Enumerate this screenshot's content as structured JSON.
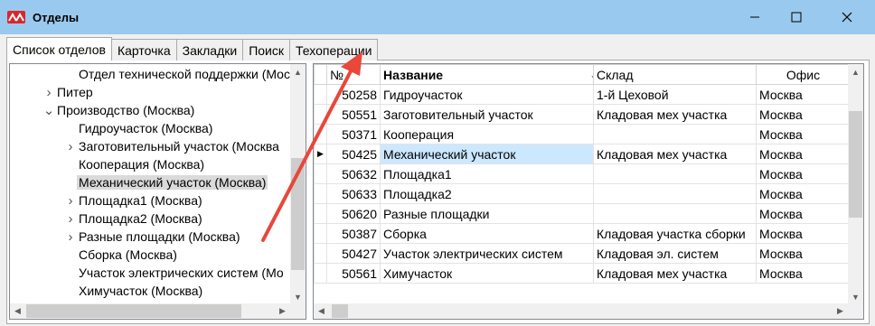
{
  "window": {
    "title": "Отделы"
  },
  "tabs": [
    {
      "label": "Список отделов",
      "active": true
    },
    {
      "label": "Карточка",
      "active": false
    },
    {
      "label": "Закладки",
      "active": false
    },
    {
      "label": "Поиск",
      "active": false
    },
    {
      "label": "Техоперации",
      "active": false
    }
  ],
  "tree": {
    "items": [
      {
        "label": "Отдел технической поддержки (Москва",
        "level": 1,
        "expander": "none",
        "selected": false
      },
      {
        "label": "Питер",
        "level": 0,
        "expander": "collapsed",
        "selected": false
      },
      {
        "label": "Производство (Москва)",
        "level": 0,
        "expander": "expanded",
        "selected": false
      },
      {
        "label": "Гидроучасток (Москва)",
        "level": 1,
        "expander": "none",
        "selected": false
      },
      {
        "label": "Заготовительный участок (Москва",
        "level": 1,
        "expander": "collapsed",
        "selected": false
      },
      {
        "label": "Кооперация (Москва)",
        "level": 1,
        "expander": "none",
        "selected": false
      },
      {
        "label": "Механический участок (Москва)",
        "level": 1,
        "expander": "none",
        "selected": true
      },
      {
        "label": "Площадка1 (Москва)",
        "level": 1,
        "expander": "collapsed",
        "selected": false
      },
      {
        "label": "Площадка2 (Москва)",
        "level": 1,
        "expander": "collapsed",
        "selected": false
      },
      {
        "label": "Разные площадки (Москва)",
        "level": 1,
        "expander": "collapsed",
        "selected": false
      },
      {
        "label": "Сборка (Москва)",
        "level": 1,
        "expander": "none",
        "selected": false
      },
      {
        "label": "Участок электрических систем (Мо",
        "level": 1,
        "expander": "none",
        "selected": false
      },
      {
        "label": "Химучасток (Москва)",
        "level": 1,
        "expander": "none",
        "selected": false
      }
    ]
  },
  "grid": {
    "columns": {
      "num": "№",
      "name": "Название",
      "store": "Склад",
      "office": "Офис"
    },
    "sort_indicator": "↓",
    "rows": [
      {
        "num": "50258",
        "name": "Гидроучасток",
        "store": "1-й Цеховой",
        "office": "Москва",
        "current": false
      },
      {
        "num": "50551",
        "name": "Заготовительный участок",
        "store": "Кладовая мех участка",
        "office": "Москва",
        "current": false
      },
      {
        "num": "50371",
        "name": "Кооперация",
        "store": "",
        "office": "Москва",
        "current": false
      },
      {
        "num": "50425",
        "name": "Механический участок",
        "store": "Кладовая мех участка",
        "office": "Москва",
        "current": true
      },
      {
        "num": "50632",
        "name": "Площадка1",
        "store": "",
        "office": "Москва",
        "current": false
      },
      {
        "num": "50633",
        "name": "Площадка2",
        "store": "",
        "office": "Москва",
        "current": false
      },
      {
        "num": "50620",
        "name": "Разные площадки",
        "store": "",
        "office": "Москва",
        "current": false
      },
      {
        "num": "50387",
        "name": "Сборка",
        "store": "Кладовая участка сборки",
        "office": "Москва",
        "current": false
      },
      {
        "num": "50427",
        "name": "Участок электрических систем",
        "store": "Кладовая эл. систем",
        "office": "Москва",
        "current": false
      },
      {
        "num": "50561",
        "name": "Химучасток",
        "store": "Кладовая мех участка",
        "office": "Москва",
        "current": false
      }
    ]
  },
  "annotation": {
    "color": "#e8473a"
  }
}
